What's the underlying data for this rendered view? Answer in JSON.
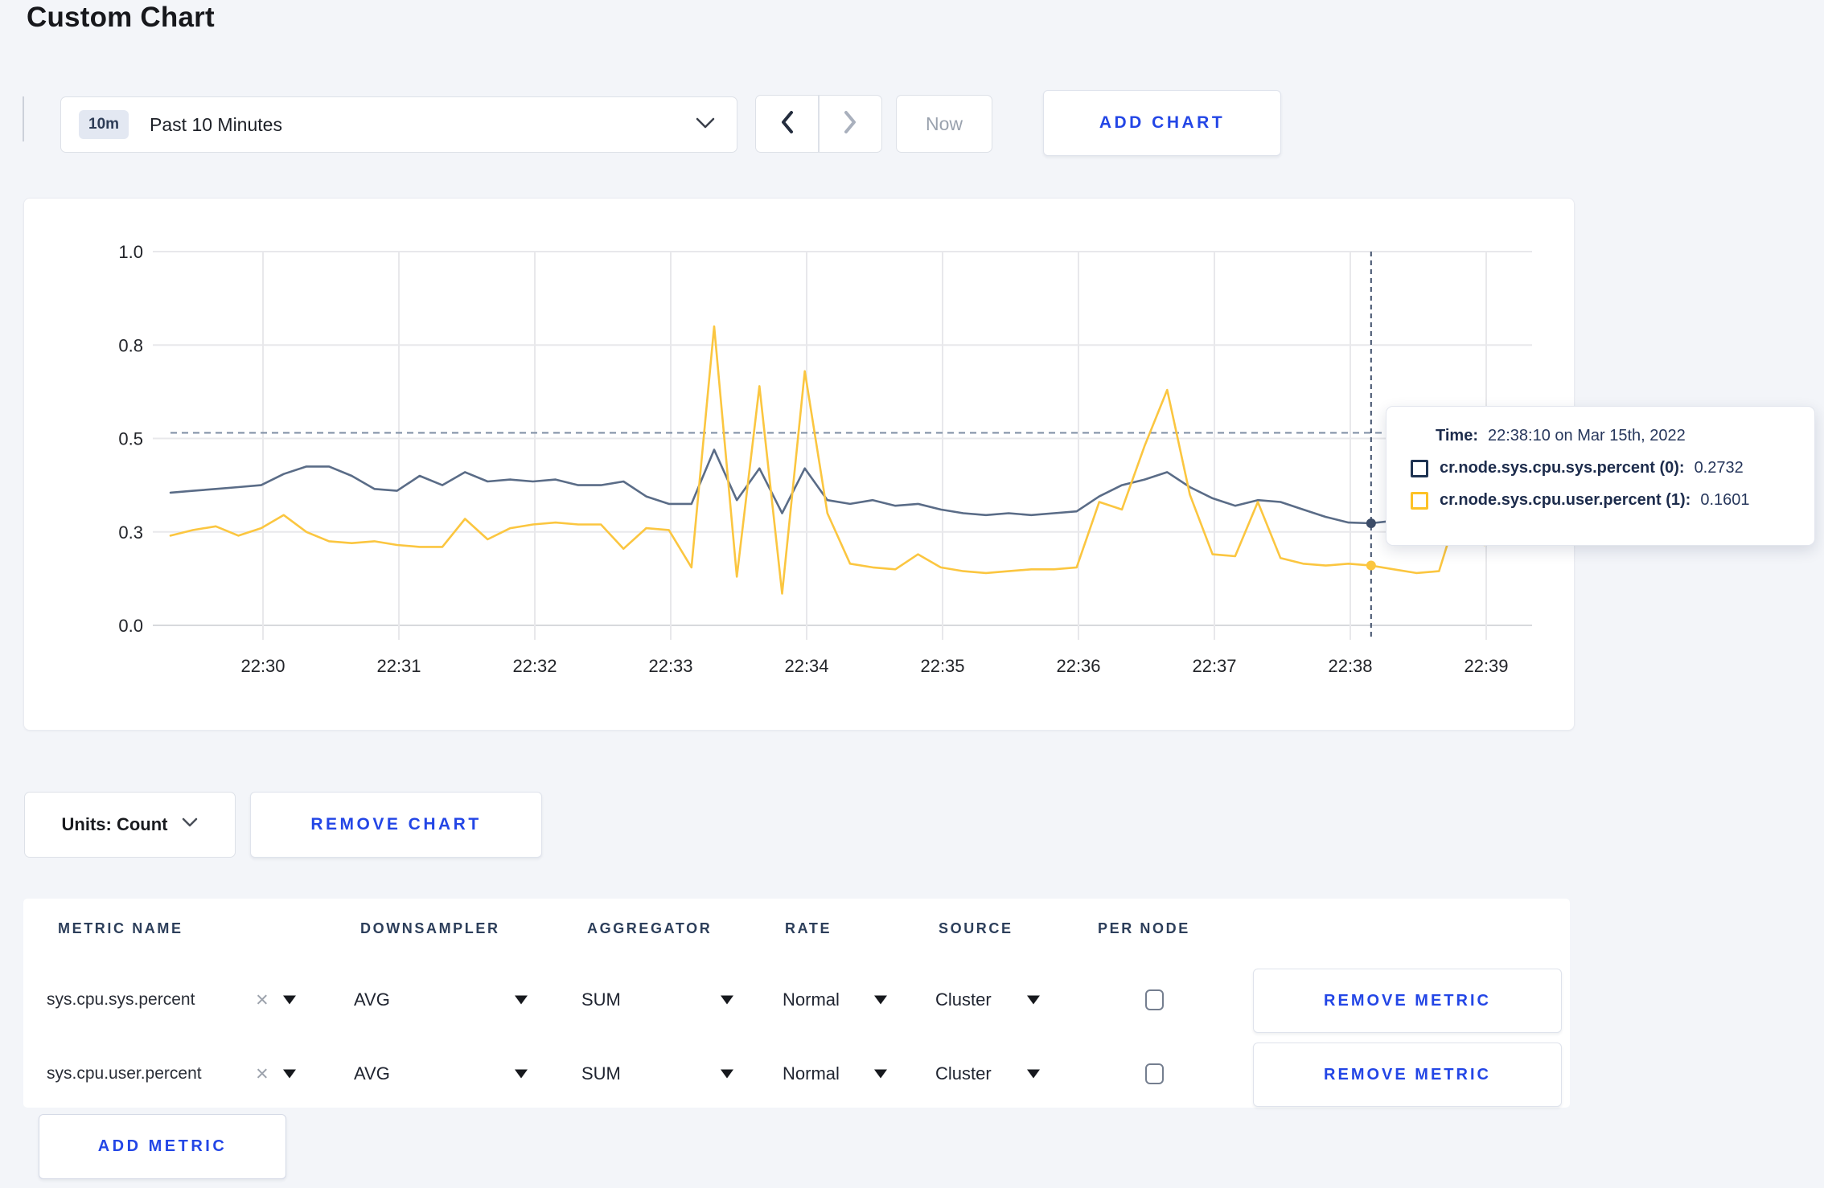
{
  "page": {
    "title": "Custom Chart",
    "background": "#f3f5f9",
    "accent_blue": "#2346e6"
  },
  "toolbar": {
    "range_badge": "10m",
    "range_label": "Past 10 Minutes",
    "now_label": "Now",
    "add_chart_label": "ADD CHART"
  },
  "icons": {
    "clear": "×"
  },
  "chart_data": {
    "type": "line",
    "title": "",
    "xlabel": "",
    "ylabel": "",
    "ylim": [
      0,
      1
    ],
    "grid": true,
    "x_ticks": [
      "22:30",
      "22:31",
      "22:32",
      "22:33",
      "22:34",
      "22:35",
      "22:36",
      "22:37",
      "22:38",
      "22:39"
    ],
    "y_ticks": [
      {
        "label": "0.0",
        "value": 0
      },
      {
        "label": "0.3",
        "value": 0.25
      },
      {
        "label": "0.5",
        "value": 0.5
      },
      {
        "label": "0.8",
        "value": 0.75
      },
      {
        "label": "1.0",
        "value": 1
      }
    ],
    "start_time": "22:29:20",
    "step_seconds": 10,
    "threshold": 0.515,
    "crosshair": {
      "time": "22:38:10",
      "index": 53
    },
    "series": [
      {
        "name": "cr.node.sys.cpu.sys.percent",
        "color": "#5a6c87",
        "swatch": "#1f3352",
        "dot": "#3c4c68",
        "values": [
          0.355,
          0.36,
          0.365,
          0.37,
          0.375,
          0.405,
          0.425,
          0.425,
          0.4,
          0.365,
          0.36,
          0.4,
          0.375,
          0.41,
          0.385,
          0.39,
          0.385,
          0.39,
          0.375,
          0.375,
          0.385,
          0.345,
          0.325,
          0.325,
          0.47,
          0.335,
          0.42,
          0.3,
          0.42,
          0.335,
          0.325,
          0.335,
          0.32,
          0.325,
          0.31,
          0.3,
          0.295,
          0.3,
          0.295,
          0.3,
          0.305,
          0.345,
          0.375,
          0.39,
          0.41,
          0.37,
          0.34,
          0.32,
          0.335,
          0.33,
          0.31,
          0.29,
          0.275,
          0.2732,
          0.28,
          0.29,
          0.3,
          0.295,
          0.29,
          0.3
        ]
      },
      {
        "name": "cr.node.sys.cpu.user.percent",
        "color": "#fbc640",
        "swatch": "#fdc226",
        "dot": "#fbc640",
        "values": [
          0.24,
          0.255,
          0.265,
          0.24,
          0.26,
          0.295,
          0.25,
          0.225,
          0.22,
          0.225,
          0.215,
          0.21,
          0.21,
          0.285,
          0.23,
          0.26,
          0.27,
          0.275,
          0.27,
          0.27,
          0.205,
          0.26,
          0.255,
          0.155,
          0.8,
          0.13,
          0.64,
          0.085,
          0.68,
          0.3,
          0.165,
          0.155,
          0.15,
          0.19,
          0.155,
          0.145,
          0.14,
          0.145,
          0.15,
          0.15,
          0.155,
          0.33,
          0.31,
          0.48,
          0.63,
          0.35,
          0.19,
          0.185,
          0.33,
          0.18,
          0.165,
          0.16,
          0.165,
          0.1601,
          0.15,
          0.14,
          0.145,
          0.34,
          0.215,
          0.27
        ]
      }
    ]
  },
  "tooltip": {
    "time_label": "Time:",
    "time_value": "22:38:10 on Mar 15th, 2022",
    "rows": [
      {
        "label": "cr.node.sys.cpu.sys.percent (0):",
        "value": "0.2732"
      },
      {
        "label": "cr.node.sys.cpu.user.percent (1):",
        "value": "0.1601"
      }
    ]
  },
  "chart_footer": {
    "units_label": "Units: Count",
    "remove_chart_label": "REMOVE CHART"
  },
  "metrics_table": {
    "headers": [
      "METRIC NAME",
      "DOWNSAMPLER",
      "AGGREGATOR",
      "RATE",
      "SOURCE",
      "PER NODE"
    ],
    "rows": [
      {
        "metric": "sys.cpu.sys.percent",
        "downsampler": "AVG",
        "aggregator": "SUM",
        "rate": "Normal",
        "source": "Cluster",
        "per_node": false,
        "remove_label": "REMOVE METRIC"
      },
      {
        "metric": "sys.cpu.user.percent",
        "downsampler": "AVG",
        "aggregator": "SUM",
        "rate": "Normal",
        "source": "Cluster",
        "per_node": false,
        "remove_label": "REMOVE METRIC"
      }
    ],
    "add_metric_label": "ADD METRIC"
  }
}
